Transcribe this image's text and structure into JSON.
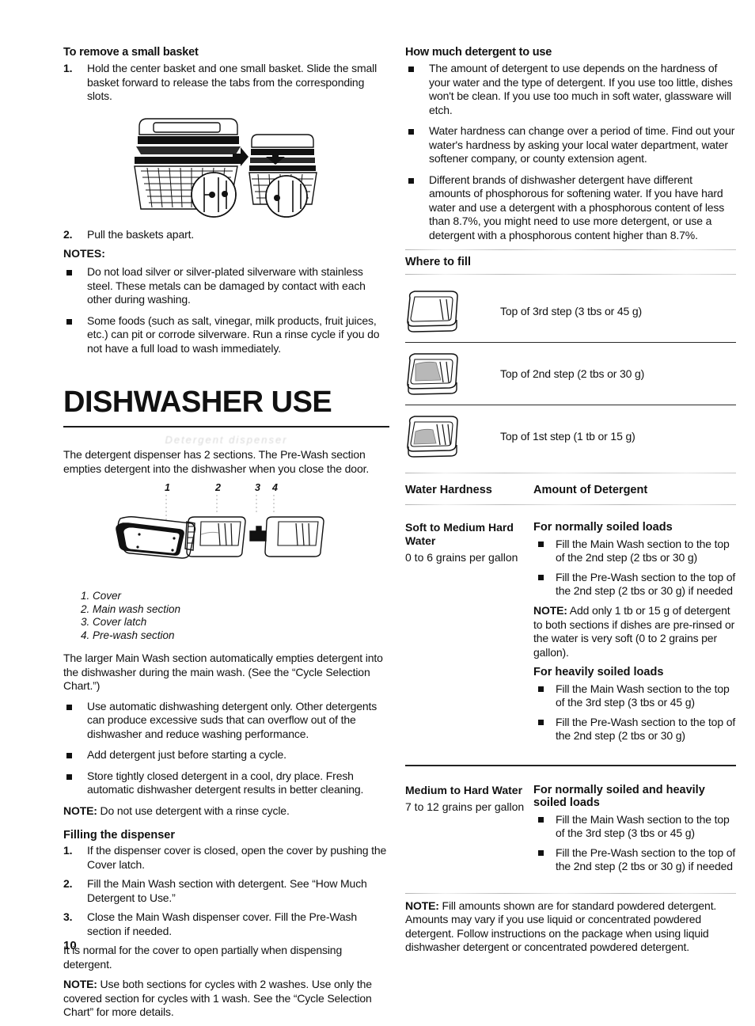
{
  "page": {
    "number": "10",
    "big_title": "DISHWASHER USE",
    "ghost_heading": "Detergent dispenser"
  },
  "left": {
    "remove_basket": {
      "heading": "To remove a small basket",
      "steps": [
        {
          "n": "1.",
          "text": "Hold the center basket and one small basket. Slide the small basket forward to release the tabs from the corresponding slots."
        },
        {
          "n": "2.",
          "text": "Pull the baskets apart."
        }
      ]
    },
    "notes_label": "NOTES:",
    "notes": [
      "Do not load silver or silver-plated silverware with stainless steel. These metals can be damaged by contact with each other during washing.",
      "Some foods (such as salt, vinegar, milk products, fruit juices, etc.) can pit or corrode silverware. Run a rinse cycle if you do not have a full load to wash immediately."
    ],
    "dispenser_intro": "The detergent dispenser has 2 sections. The Pre-Wash section empties detergent into the dishwasher when you close the door.",
    "diagram_callouts": [
      "1",
      "2",
      "3",
      "4"
    ],
    "diagram_legend": [
      "1. Cover",
      "2. Main wash section",
      "3. Cover latch",
      "4. Pre-wash section"
    ],
    "main_wash_para": "The larger Main Wash section automatically empties detergent into the dishwasher during the main wash. (See the “Cycle Selection Chart.”)",
    "detergent_bullets": [
      "Use automatic dishwashing detergent only. Other detergents can produce excessive suds that can overflow out of the dishwasher and reduce washing performance.",
      "Add detergent just before starting a cycle.",
      "Store tightly closed detergent in a cool, dry place. Fresh automatic dishwasher detergent results in better cleaning."
    ],
    "note_rinse_label": "NOTE:",
    "note_rinse_text": " Do not use detergent with a rinse cycle.",
    "filling": {
      "heading": "Filling the dispenser",
      "steps": [
        {
          "n": "1.",
          "text": "If the dispenser cover is closed, open the cover by pushing the Cover latch."
        },
        {
          "n": "2.",
          "text": "Fill the Main Wash section with detergent. See “How Much Detergent to Use.”"
        },
        {
          "n": "3.",
          "text": "Close the Main Wash dispenser cover. Fill the Pre-Wash section if needed."
        }
      ],
      "normal_para": "It is normal for the cover to open partially when dispensing detergent.",
      "note_label": "NOTE:",
      "note_text": " Use both sections for cycles with 2 washes. Use only the covered section for cycles with 1 wash. See the “Cycle Selection Chart” for more details."
    }
  },
  "right": {
    "how_much": {
      "heading": "How much detergent to use",
      "bullets": [
        "The amount of detergent to use depends on the hardness of your water and the type of detergent. If you use too little, dishes won't be clean. If you use too much in soft water, glassware will etch.",
        "Water hardness can change over a period of time. Find out your water's hardness by asking your local water department, water softener company, or county extension agent.",
        "Different brands of dishwasher detergent have different amounts of phosphorous for softening water. If you have hard water and use a detergent with a phosphorous content of less than 8.7%, you might need to use more detergent, or use a detergent with a phosphorous content higher than 8.7%."
      ]
    },
    "where_to_fill": {
      "heading": "Where to fill",
      "rows": [
        {
          "icon": "detergent-cup-3rd-step",
          "label": "Top of 3rd step (3 tbs or 45 g)",
          "fill_level": 0
        },
        {
          "icon": "detergent-cup-2nd-step",
          "label": "Top of 2nd step (2 tbs or 30 g)",
          "fill_level": 2
        },
        {
          "icon": "detergent-cup-1st-step",
          "label": "Top of 1st step (1 tb or 15 g)",
          "fill_level": 1
        }
      ]
    },
    "hardness_table": {
      "headers": [
        "Water Hardness",
        "Amount of Detergent"
      ],
      "rows": [
        {
          "hardness_title": "Soft to Medium Hard Water",
          "hardness_sub": "0 to 6 grains per gallon",
          "blocks": [
            {
              "title": "For normally soiled loads",
              "bullets": [
                "Fill the Main Wash section to the top of the 2nd step (2 tbs or 30 g)",
                "Fill the Pre-Wash section to the top of the 2nd step (2 tbs or 30 g) if needed"
              ],
              "note_label": "NOTE:",
              "note_text": " Add only 1 tb or 15 g of detergent to both sections if dishes are pre-rinsed or the water is very soft (0 to 2 grains per gallon)."
            },
            {
              "title": "For heavily soiled loads",
              "bullets": [
                "Fill the Main Wash section to the top of the 3rd step (3 tbs or 45 g)",
                "Fill the Pre-Wash section to the top of the 2nd step (2 tbs or 30 g)"
              ],
              "note_label": "",
              "note_text": ""
            }
          ]
        },
        {
          "hardness_title": "Medium to Hard Water",
          "hardness_sub": "7 to 12 grains per gallon",
          "blocks": [
            {
              "title": "For normally soiled and heavily soiled loads",
              "bullets": [
                "Fill the Main Wash section to the top of the 3rd step (3 tbs or 45 g)",
                "Fill the Pre-Wash section to the top of the 2nd step (2 tbs or 30 g) if needed"
              ],
              "note_label": "",
              "note_text": ""
            }
          ]
        }
      ]
    },
    "final_note_label": "NOTE:",
    "final_note_text": " Fill amounts shown are for standard powdered detergent. Amounts may vary if you use liquid or concentrated powdered detergent. Follow instructions on the package when using liquid dishwasher detergent or concentrated powdered detergent."
  }
}
